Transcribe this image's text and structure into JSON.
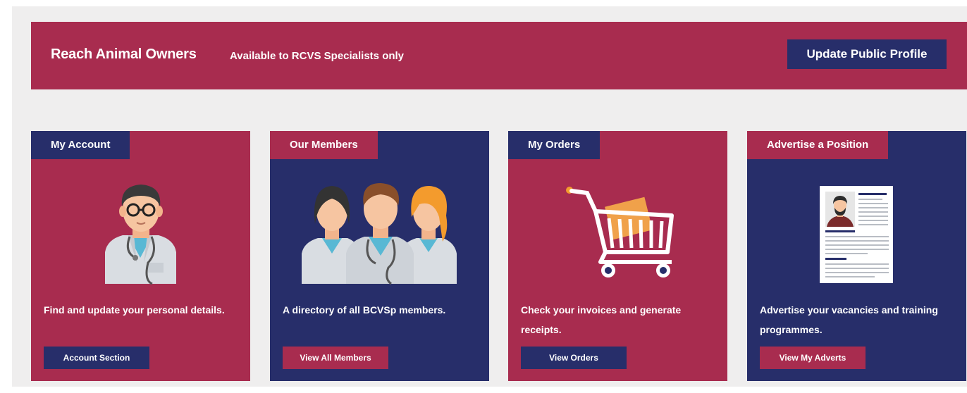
{
  "banner": {
    "title": "Reach Animal Owners",
    "subtitle": "Available to RCVS Specialists only",
    "button_label": "Update Public Profile"
  },
  "cards": [
    {
      "title": "My Account",
      "description": "Find and update your personal details.",
      "button_label": "Account Section",
      "illustration": "doctor-avatar-icon"
    },
    {
      "title": "Our Members",
      "description": "A directory of all BCVSp members.",
      "button_label": "View All Members",
      "illustration": "members-group-icon"
    },
    {
      "title": "My Orders",
      "description": "Check your invoices and generate receipts.",
      "button_label": "View Orders",
      "illustration": "shopping-cart-icon"
    },
    {
      "title": "Advertise a Position",
      "description": "Advertise your vacancies and training programmes.",
      "button_label": "View My Adverts",
      "illustration": "cv-document-icon"
    }
  ],
  "colors": {
    "crimson": "#a82c4f",
    "navy": "#272e6a",
    "page_bg": "#efeeee"
  }
}
